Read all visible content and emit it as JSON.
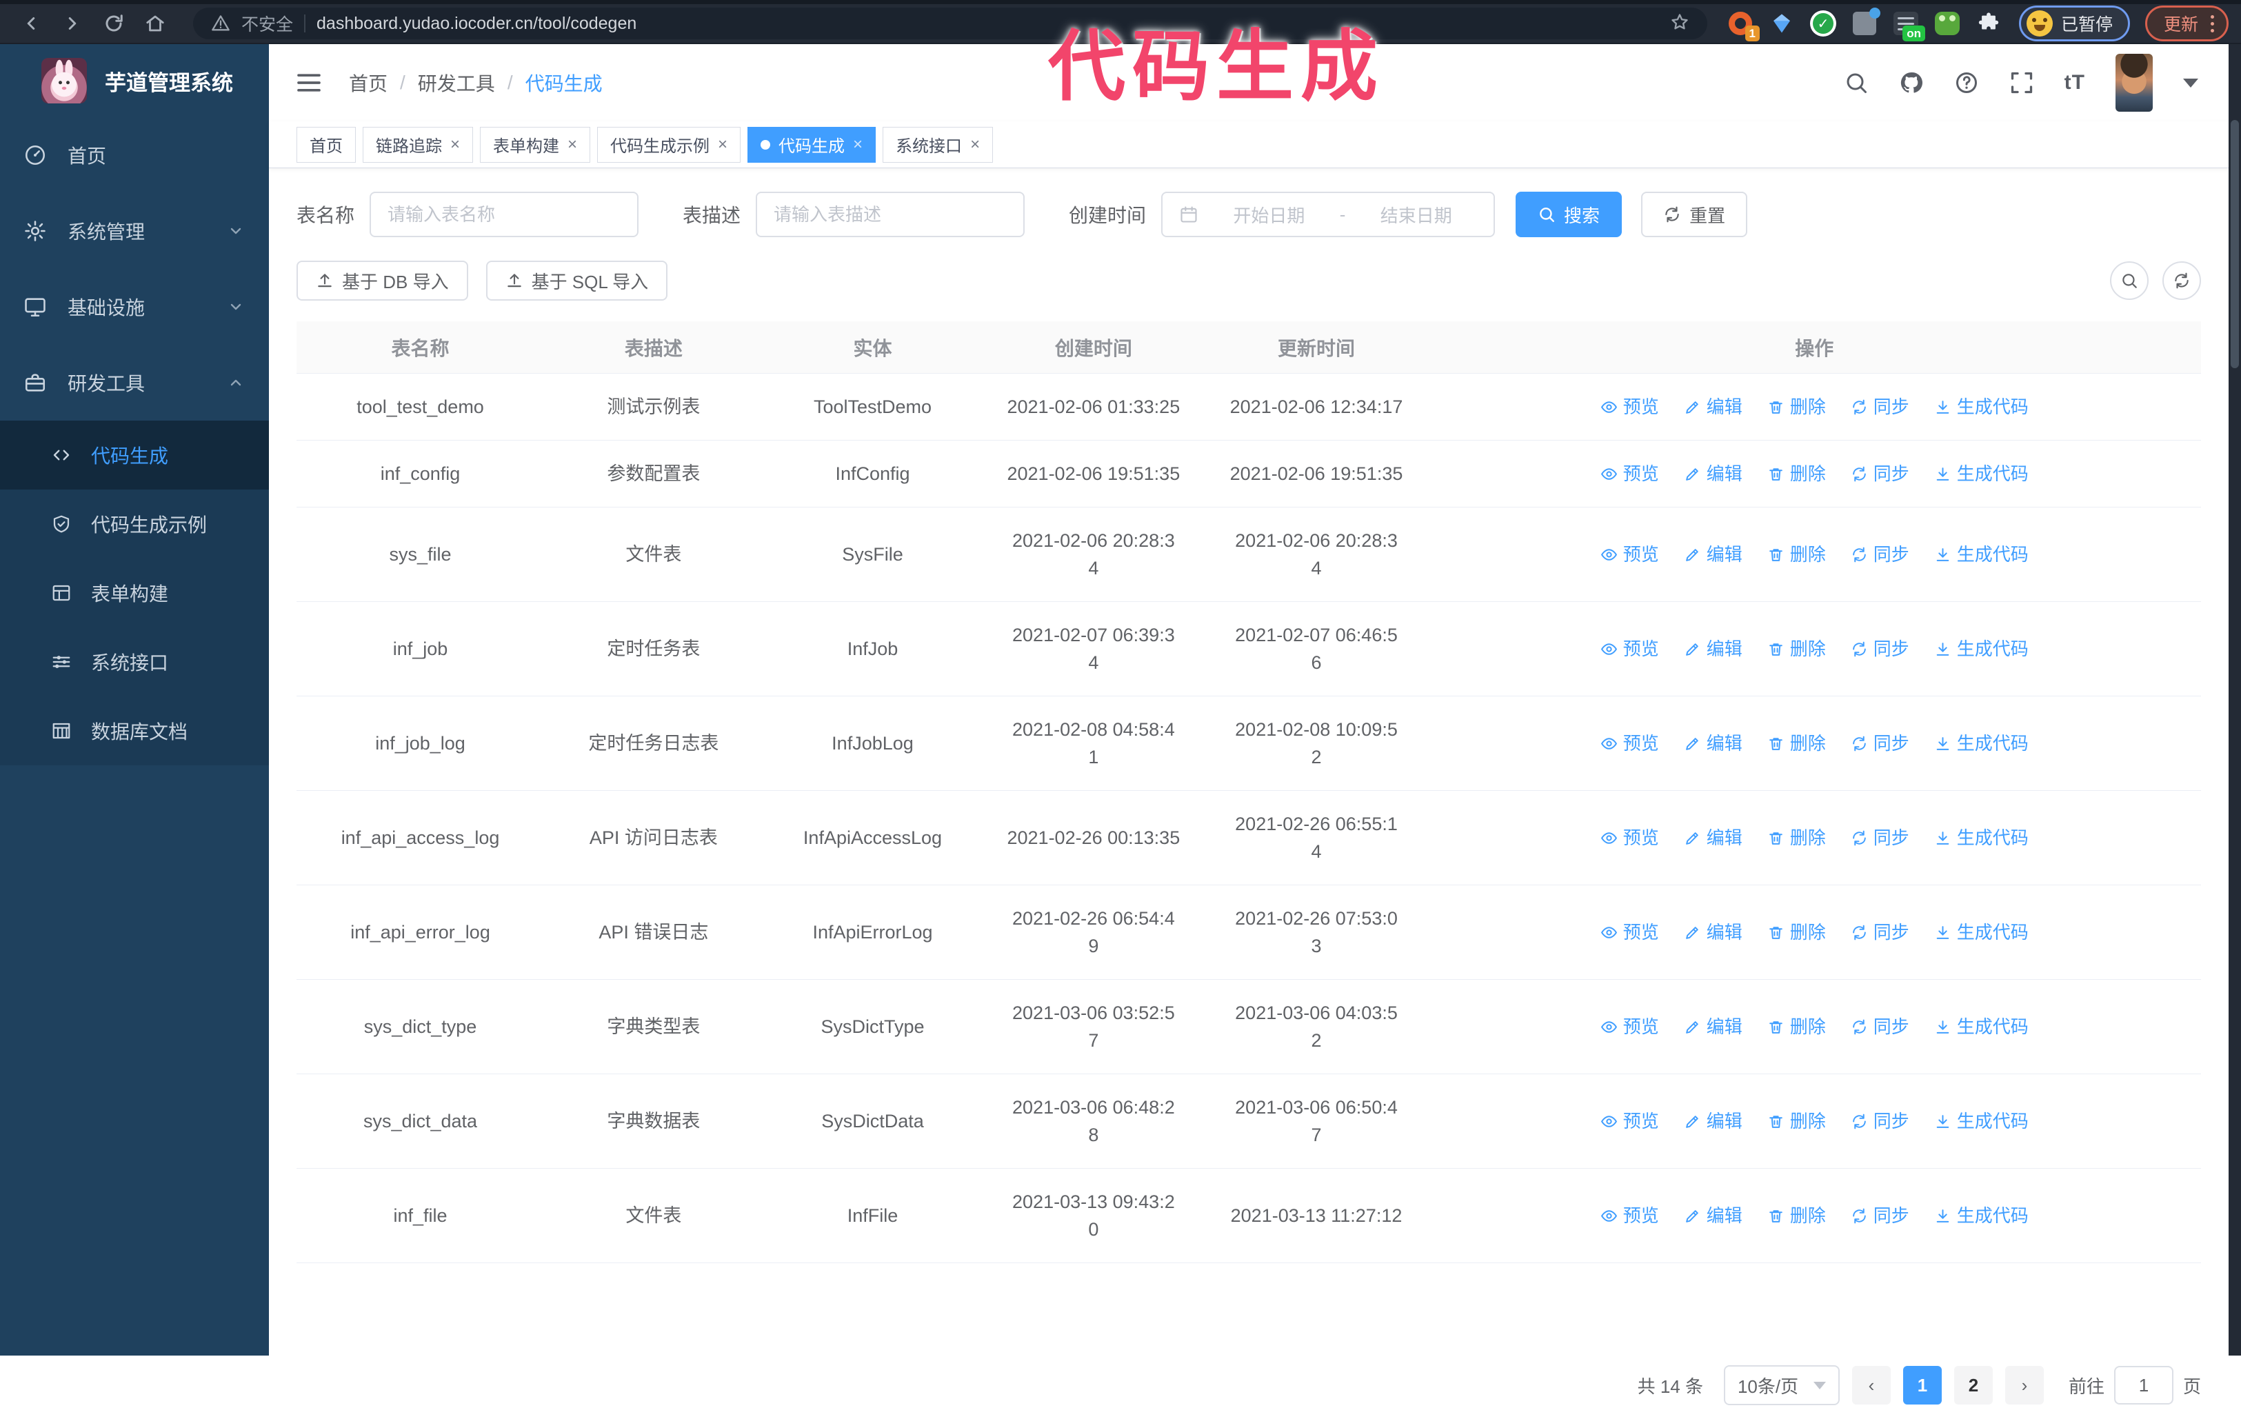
{
  "browser": {
    "security_label": "不安全",
    "url": "dashboard.yudao.iocoder.cn/tool/codegen",
    "extension_badge": "1",
    "extension_on_badge": "on",
    "profile_chip_label": "已暂停",
    "update_button_label": "更新"
  },
  "annotation": {
    "text": "代码生成",
    "color": "#f2456b"
  },
  "sidebar": {
    "title": "芋道管理系统",
    "items": [
      {
        "label": "首页"
      },
      {
        "label": "系统管理"
      },
      {
        "label": "基础设施"
      },
      {
        "label": "研发工具"
      }
    ],
    "sub_items": [
      {
        "label": "代码生成",
        "active": true
      },
      {
        "label": "代码生成示例"
      },
      {
        "label": "表单构建"
      },
      {
        "label": "系统接口"
      },
      {
        "label": "数据库文档"
      }
    ]
  },
  "header": {
    "breadcrumb": [
      "首页",
      "研发工具",
      "代码生成"
    ],
    "separator": "/"
  },
  "tabs": [
    {
      "label": "首页"
    },
    {
      "label": "链路追踪"
    },
    {
      "label": "表单构建"
    },
    {
      "label": "代码生成示例"
    },
    {
      "label": "代码生成"
    },
    {
      "label": "系统接口"
    }
  ],
  "search_form": {
    "table_name_label": "表名称",
    "table_name_placeholder": "请输入表名称",
    "table_desc_label": "表描述",
    "table_desc_placeholder": "请输入表描述",
    "create_time_label": "创建时间",
    "start_date_placeholder": "开始日期",
    "range_separator": "-",
    "end_date_placeholder": "结束日期",
    "search_label": "搜索",
    "reset_label": "重置"
  },
  "toolbar": {
    "import_db_label": "基于 DB 导入",
    "import_sql_label": "基于 SQL 导入"
  },
  "table": {
    "columns": [
      "表名称",
      "表描述",
      "实体",
      "创建时间",
      "更新时间",
      "操作"
    ],
    "actions": [
      "预览",
      "编辑",
      "删除",
      "同步",
      "生成代码"
    ],
    "rows": [
      {
        "name": "tool_test_demo",
        "desc": "测试示例表",
        "entity": "ToolTestDemo",
        "created": "2021-02-06 01:33:25",
        "updated": "2021-02-06 12:34:17"
      },
      {
        "name": "inf_config",
        "desc": "参数配置表",
        "entity": "InfConfig",
        "created": "2021-02-06 19:51:35",
        "updated": "2021-02-06 19:51:35"
      },
      {
        "name": "sys_file",
        "desc": "文件表",
        "entity": "SysFile",
        "created": "2021-02-06 20:28:3\n4",
        "updated": "2021-02-06 20:28:3\n4"
      },
      {
        "name": "inf_job",
        "desc": "定时任务表",
        "entity": "InfJob",
        "created": "2021-02-07 06:39:3\n4",
        "updated": "2021-02-07 06:46:5\n6"
      },
      {
        "name": "inf_job_log",
        "desc": "定时任务日志表",
        "entity": "InfJobLog",
        "created": "2021-02-08 04:58:4\n1",
        "updated": "2021-02-08 10:09:5\n2"
      },
      {
        "name": "inf_api_access_log",
        "desc": "API 访问日志表",
        "entity": "InfApiAccessLog",
        "created": "2021-02-26 00:13:35",
        "updated": "2021-02-26 06:55:1\n4"
      },
      {
        "name": "inf_api_error_log",
        "desc": "API 错误日志",
        "entity": "InfApiErrorLog",
        "created": "2021-02-26 06:54:4\n9",
        "updated": "2021-02-26 07:53:0\n3"
      },
      {
        "name": "sys_dict_type",
        "desc": "字典类型表",
        "entity": "SysDictType",
        "created": "2021-03-06 03:52:5\n7",
        "updated": "2021-03-06 04:03:5\n2"
      },
      {
        "name": "sys_dict_data",
        "desc": "字典数据表",
        "entity": "SysDictData",
        "created": "2021-03-06 06:48:2\n8",
        "updated": "2021-03-06 06:50:4\n7"
      },
      {
        "name": "inf_file",
        "desc": "文件表",
        "entity": "InfFile",
        "created": "2021-03-13 09:43:2\n0",
        "updated": "2021-03-13 11:27:12"
      }
    ]
  },
  "pagination": {
    "total_label": "共 14 条",
    "page_size": "10条/页",
    "prev": "‹",
    "pages": [
      "1",
      "2"
    ],
    "next": "›",
    "goto_label": "前往",
    "goto_value": "1",
    "page_suffix": "页"
  },
  "colors": {
    "accent": "#409eff",
    "sidebar_bg": "#1f415e",
    "topbar_bg": "#242b36",
    "annotation": "#f2456b"
  }
}
